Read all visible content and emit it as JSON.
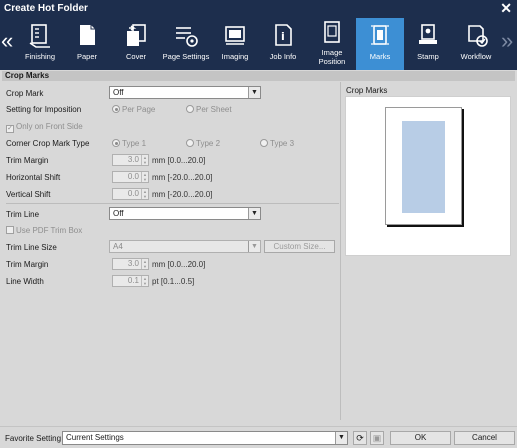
{
  "window": {
    "title": "Create Hot Folder"
  },
  "toolbar": {
    "items": [
      {
        "label": "Finishing",
        "icon": "finishing-icon"
      },
      {
        "label": "Paper",
        "icon": "paper-icon"
      },
      {
        "label": "Cover",
        "icon": "cover-icon"
      },
      {
        "label": "Page Settings",
        "icon": "page-settings-icon"
      },
      {
        "label": "Imaging",
        "icon": "imaging-icon"
      },
      {
        "label": "Job Info",
        "icon": "job-info-icon"
      },
      {
        "label": "Image Position",
        "icon": "image-position-icon"
      },
      {
        "label": "Marks",
        "icon": "marks-icon",
        "active": true
      },
      {
        "label": "Stamp",
        "icon": "stamp-icon"
      },
      {
        "label": "Workflow",
        "icon": "workflow-icon"
      }
    ],
    "active_color": "#3d8fd4",
    "background_color": "#1d2e4d"
  },
  "section": {
    "title": "Crop Marks"
  },
  "form": {
    "crop_mark": {
      "label": "Crop Mark",
      "value": "Off"
    },
    "imposition": {
      "label": "Setting for Imposition",
      "options": [
        "Per Page",
        "Per Sheet"
      ],
      "selected": "Per Page"
    },
    "front_side": {
      "label": "Only on Front Side",
      "checked": true
    },
    "corner_type": {
      "label": "Corner Crop Mark Type",
      "options": [
        "Type 1",
        "Type 2",
        "Type 3"
      ],
      "selected": "Type 1"
    },
    "trim_margin": {
      "label": "Trim Margin",
      "value": "3.0",
      "unit": "mm [0.0...20.0]"
    },
    "h_shift": {
      "label": "Horizontal Shift",
      "value": "0.0",
      "unit": "mm [-20.0...20.0]"
    },
    "v_shift": {
      "label": "Vertical Shift",
      "value": "0.0",
      "unit": "mm [-20.0...20.0]"
    },
    "trim_line": {
      "label": "Trim Line",
      "value": "Off"
    },
    "pdf_trim": {
      "label": "Use PDF Trim Box",
      "checked": false
    },
    "trim_size": {
      "label": "Trim Line Size",
      "value": "A4",
      "custom_button": "Custom Size..."
    },
    "trim_margin2": {
      "label": "Trim Margin",
      "value": "3.0",
      "unit": "mm [0.0...20.0]"
    },
    "line_width": {
      "label": "Line Width",
      "value": "0.1",
      "unit": "pt [0.1...0.5]"
    }
  },
  "preview": {
    "title": "Crop Marks"
  },
  "footer": {
    "favorite_label": "Favorite Setting",
    "favorite_value": "Current Settings",
    "ok": "OK",
    "cancel": "Cancel"
  }
}
